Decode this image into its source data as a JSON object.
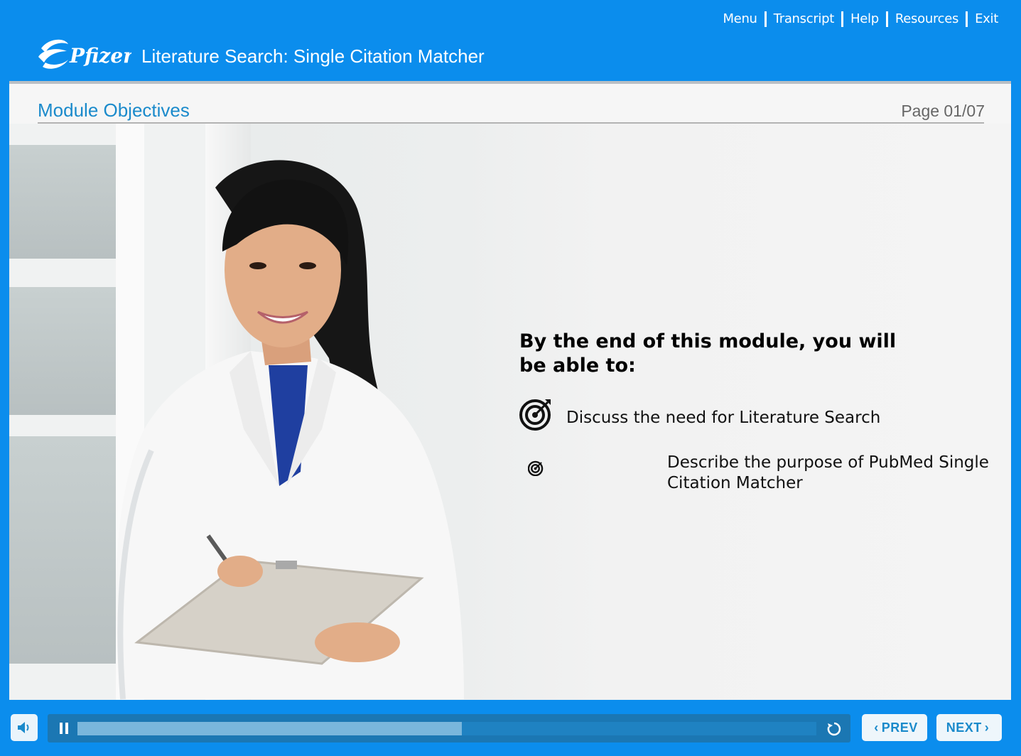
{
  "header": {
    "nav": [
      "Menu",
      "Transcript",
      "Help",
      "Resources",
      "Exit"
    ],
    "logo_text": "Pfizer",
    "course_title": "Literature Search: Single Citation Matcher"
  },
  "slide": {
    "title": "Module Objectives",
    "page": "Page 01/07",
    "heading": "By the end of this module, you will be able to:",
    "objectives": [
      {
        "icon": "target-icon",
        "text": "Discuss the need for Literature Search"
      },
      {
        "icon": "target-icon",
        "text": "Describe the purpose of PubMed Single Citation Matcher"
      }
    ]
  },
  "player": {
    "progress_fraction": 0.52,
    "prev_label": "PREV",
    "next_label": "NEXT",
    "icons": [
      "speaker-icon",
      "pause-icon",
      "replay-icon",
      "chevron-left-icon",
      "chevron-right-icon"
    ]
  },
  "colors": {
    "brand": "#0b8ded",
    "title_blue": "#1a8acb",
    "progress_fill": "#79b6dc"
  }
}
